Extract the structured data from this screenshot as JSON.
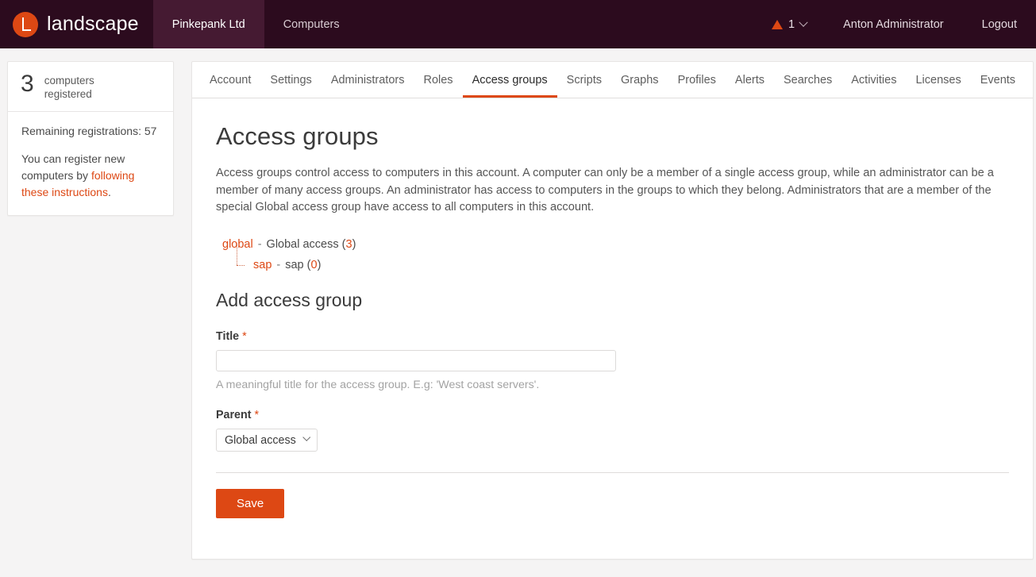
{
  "header": {
    "brand": "landscape",
    "logo_icon": "landscape-logo-icon",
    "nav": [
      {
        "label": "Pinkepank Ltd",
        "active": true
      },
      {
        "label": "Computers",
        "active": false
      }
    ],
    "alerts": {
      "icon": "alert-triangle-icon",
      "count": "1",
      "chevron": "chevron-down-icon"
    },
    "user": "Anton Administrator",
    "logout": "Logout",
    "colors": {
      "bar": "#2c0b1e",
      "bar_active": "#451a32",
      "accent": "#dd4814"
    }
  },
  "sidebar": {
    "count": "3",
    "count_label": "computers\nregistered",
    "count_label_line1": "computers",
    "count_label_line2": "registered",
    "remaining_text": "Remaining registrations: 57",
    "register_text_before": "You can register new computers by ",
    "register_link": "following these instructions",
    "register_text_after": "."
  },
  "tabs": [
    {
      "label": "Account",
      "active": false
    },
    {
      "label": "Settings",
      "active": false
    },
    {
      "label": "Administrators",
      "active": false
    },
    {
      "label": "Roles",
      "active": false
    },
    {
      "label": "Access groups",
      "active": true
    },
    {
      "label": "Scripts",
      "active": false
    },
    {
      "label": "Graphs",
      "active": false
    },
    {
      "label": "Profiles",
      "active": false
    },
    {
      "label": "Alerts",
      "active": false
    },
    {
      "label": "Searches",
      "active": false
    },
    {
      "label": "Activities",
      "active": false
    },
    {
      "label": "Licenses",
      "active": false
    },
    {
      "label": "Events",
      "active": false
    }
  ],
  "main": {
    "title": "Access groups",
    "description": "Access groups control access to computers in this account. A computer can only be a member of a single access group, while an administrator can be a member of many access groups. An administrator has access to computers in the groups to which they belong. Administrators that are a member of the special Global access group have access to all computers in this account.",
    "tree": [
      {
        "key": "global",
        "sep": "-",
        "name": "Global access",
        "count": "3",
        "child": false
      },
      {
        "key": "sap",
        "sep": "-",
        "name": "sap",
        "count": "0",
        "child": true
      }
    ],
    "form": {
      "heading": "Add access group",
      "title_label": "Title",
      "title_required": "*",
      "title_value": "",
      "title_placeholder": "",
      "title_hint": "A meaningful title for the access group. E.g: 'West coast servers'.",
      "parent_label": "Parent",
      "parent_required": "*",
      "parent_value": "Global access",
      "parent_chevron": "chevron-down-icon",
      "save_label": "Save"
    }
  }
}
